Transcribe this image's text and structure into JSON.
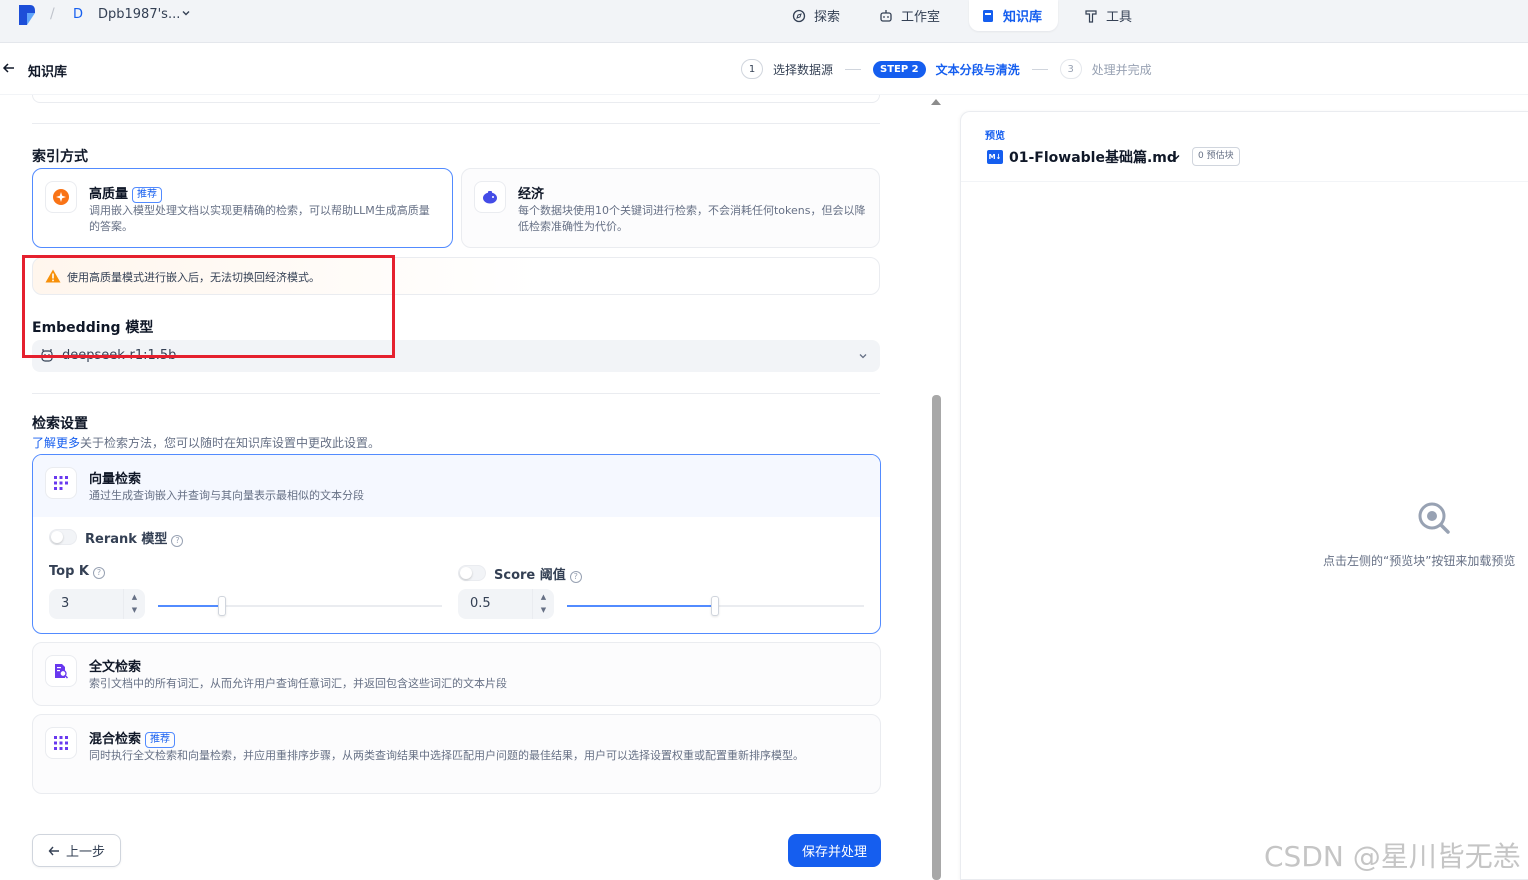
{
  "nav": {
    "workspace_initial": "D",
    "workspace_name": "Dpb1987's...",
    "tabs": [
      {
        "label": "探索",
        "icon": "compass-icon"
      },
      {
        "label": "工作室",
        "icon": "robot-icon"
      },
      {
        "label": "知识库",
        "icon": "book-icon",
        "active": true
      },
      {
        "label": "工具",
        "icon": "hammer-icon"
      }
    ]
  },
  "header": {
    "title": "知识库",
    "steps": [
      {
        "num": "1",
        "label": "选择数据源"
      },
      {
        "num": "STEP 2",
        "label": "文本分段与清洗"
      },
      {
        "num": "3",
        "label": "处理并完成"
      }
    ]
  },
  "index": {
    "title": "索引方式",
    "high_quality": {
      "title": "高质量",
      "tag": "推荐",
      "desc": "调用嵌入模型处理文档以实现更精确的检索，可以帮助LLM生成高质量的答案。"
    },
    "economy": {
      "title": "经济",
      "desc": "每个数据块使用10个关键词进行检索，不会消耗任何tokens，但会以降低检索准确性为代价。"
    },
    "warning": "使用高质量模式进行嵌入后，无法切换回经济模式。"
  },
  "embedding": {
    "title": "Embedding 模型",
    "value": "deepseek-r1:1.5b"
  },
  "retrieval": {
    "title": "检索设置",
    "help_link": "了解更多",
    "help_text": "关于检索方法，您可以随时在知识库设置中更改此设置。",
    "vector": {
      "title": "向量检索",
      "desc": "通过生成查询嵌入并查询与其向量表示最相似的文本分段",
      "rerank_label": "Rerank 模型",
      "topk_label": "Top K",
      "topk_value": "3",
      "score_label": "Score 阈值",
      "score_value": "0.5"
    },
    "fulltext": {
      "title": "全文检索",
      "desc": "索引文档中的所有词汇，从而允许用户查询任意词汇，并返回包含这些词汇的文本片段"
    },
    "hybrid": {
      "title": "混合检索",
      "tag": "推荐",
      "desc": "同时执行全文检索和向量检索，并应用重排序步骤，从两类查询结果中选择匹配用户问题的最佳结果，用户可以选择设置权重或配置重新排序模型。"
    }
  },
  "buttons": {
    "back": "上一步",
    "save": "保存并处理"
  },
  "preview": {
    "label": "预览",
    "file_badge": "M↓",
    "file": "01-Flowable基础篇.md",
    "badge": "0 预估块",
    "hint": "点击左侧的“预览块”按钮来加载预览"
  },
  "watermark": "CSDN @星川皆无恙",
  "colors": {
    "accent": "#155eef",
    "highlight_box": "#e5202e",
    "warning": "#f79009"
  }
}
